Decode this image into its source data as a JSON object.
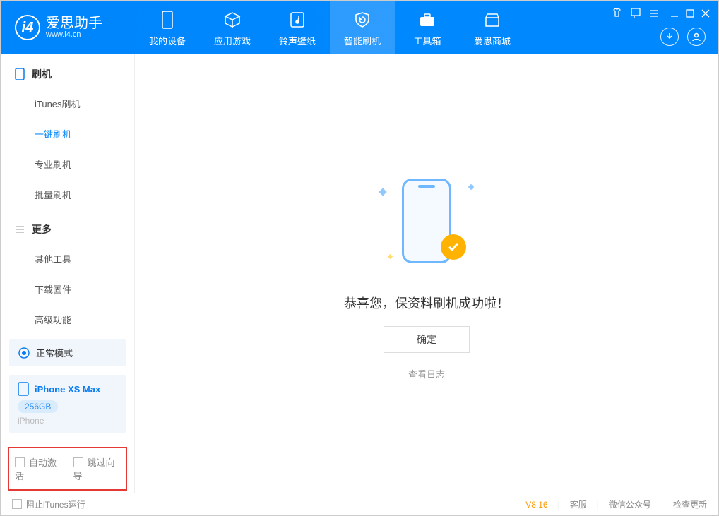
{
  "app": {
    "name": "爱思助手",
    "url": "www.i4.cn"
  },
  "header_tabs": [
    {
      "label": "我的设备"
    },
    {
      "label": "应用游戏"
    },
    {
      "label": "铃声壁纸"
    },
    {
      "label": "智能刷机",
      "active": true
    },
    {
      "label": "工具箱"
    },
    {
      "label": "爱思商城"
    }
  ],
  "sidebar": {
    "section1_title": "刷机",
    "items1": [
      {
        "label": "iTunes刷机"
      },
      {
        "label": "一键刷机",
        "active": true
      },
      {
        "label": "专业刷机"
      },
      {
        "label": "批量刷机"
      }
    ],
    "section2_title": "更多",
    "items2": [
      {
        "label": "其他工具"
      },
      {
        "label": "下载固件"
      },
      {
        "label": "高级功能"
      }
    ],
    "mode_label": "正常模式",
    "device": {
      "name": "iPhone XS Max",
      "storage": "256GB",
      "type": "iPhone"
    },
    "cb1_label": "自动激活",
    "cb2_label": "跳过向导"
  },
  "main": {
    "message": "恭喜您，保资料刷机成功啦！",
    "ok_button": "确定",
    "log_link": "查看日志"
  },
  "footer": {
    "block_itunes": "阻止iTunes运行",
    "version": "V8.16",
    "links": [
      "客服",
      "微信公众号",
      "检查更新"
    ]
  }
}
